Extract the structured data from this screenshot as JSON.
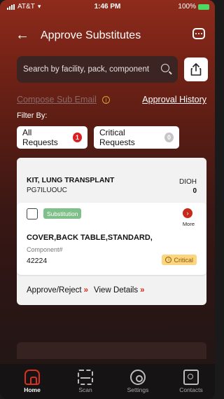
{
  "status_bar": {
    "carrier": "AT&T",
    "time": "1:46 PM",
    "battery": "100%"
  },
  "header": {
    "title": "Approve Substitutes",
    "back_icon": "back-arrow-icon",
    "chat_icon": "chat-bubble-icon"
  },
  "search": {
    "placeholder": "Search by facility, pack, component",
    "icon": "search-icon",
    "share_icon": "share-icon"
  },
  "links": {
    "compose": "Compose Sub Email",
    "compose_info_icon": "info-icon",
    "history": "Approval History"
  },
  "filter": {
    "label": "Filter By:",
    "chips": [
      {
        "label": "All Requests",
        "count": "1",
        "color": "#d92121"
      },
      {
        "label": "Critical Requests",
        "count": "0",
        "color": "#c6c6c6"
      }
    ]
  },
  "card": {
    "kit_name": "KIT, LUNG TRANSPLANT",
    "kit_code": "PG7ILUOUC",
    "dioh_label": "DIOH",
    "dioh_value": "0",
    "item": {
      "badge": "Substitution",
      "more_label": "More",
      "component_name": "COVER,BACK TABLE,STANDARD,",
      "component_label": "Component#",
      "component_number": "42224",
      "critical_label": "Critical"
    },
    "actions": {
      "approve": "Approve/Reject",
      "details": "View Details",
      "arrow_glyph": "»"
    }
  },
  "bottom_nav": [
    {
      "label": "Home",
      "icon": "home-icon",
      "active": true
    },
    {
      "label": "Scan",
      "icon": "scan-icon",
      "active": false
    },
    {
      "label": "Settings",
      "icon": "settings-gear-icon",
      "active": false
    },
    {
      "label": "Contacts",
      "icon": "contacts-icon",
      "active": false
    }
  ],
  "colors": {
    "accent_red": "#d7281b",
    "substitution_green": "#7fbf8a",
    "critical_yellow": "#fcd581"
  }
}
